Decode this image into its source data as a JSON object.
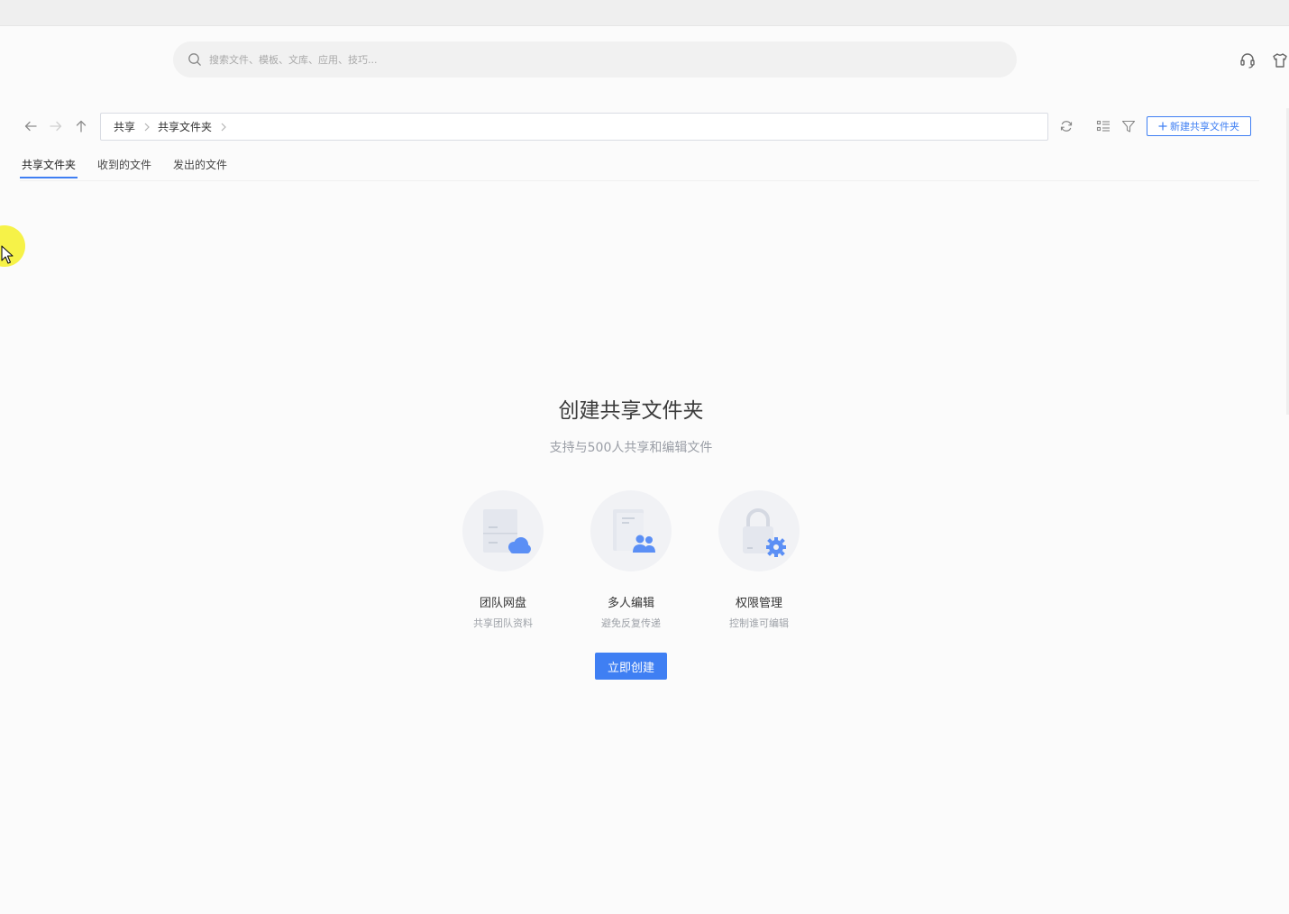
{
  "search": {
    "placeholder": "搜索文件、模板、文库、应用、技巧..."
  },
  "top_icons": [
    "headset-icon",
    "shirt-icon"
  ],
  "nav": {
    "back_icon": "arrow-left-icon",
    "forward_icon": "arrow-right-icon",
    "up_icon": "arrow-up-icon"
  },
  "breadcrumb": {
    "items": [
      "共享",
      "共享文件夹"
    ]
  },
  "toolbar": {
    "refresh_icon": "refresh-icon",
    "view_icon": "list-view-icon",
    "filter_icon": "filter-icon",
    "new_share_label": "新建共享文件夹"
  },
  "tabs": [
    "共享文件夹",
    "收到的文件",
    "发出的文件"
  ],
  "active_tab": 0,
  "empty": {
    "title": "创建共享文件夹",
    "subtitle": "支持与500人共享和编辑文件",
    "features": [
      {
        "title": "团队网盘",
        "desc": "共享团队资料",
        "icon": "team-cloud-icon"
      },
      {
        "title": "多人编辑",
        "desc": "避免反复传递",
        "icon": "multi-user-edit-icon"
      },
      {
        "title": "权限管理",
        "desc": "控制谁可编辑",
        "icon": "lock-gear-icon"
      }
    ],
    "create_label": "立即创建"
  },
  "colors": {
    "accent": "#3f7ff3",
    "background": "#fbfbfb"
  }
}
